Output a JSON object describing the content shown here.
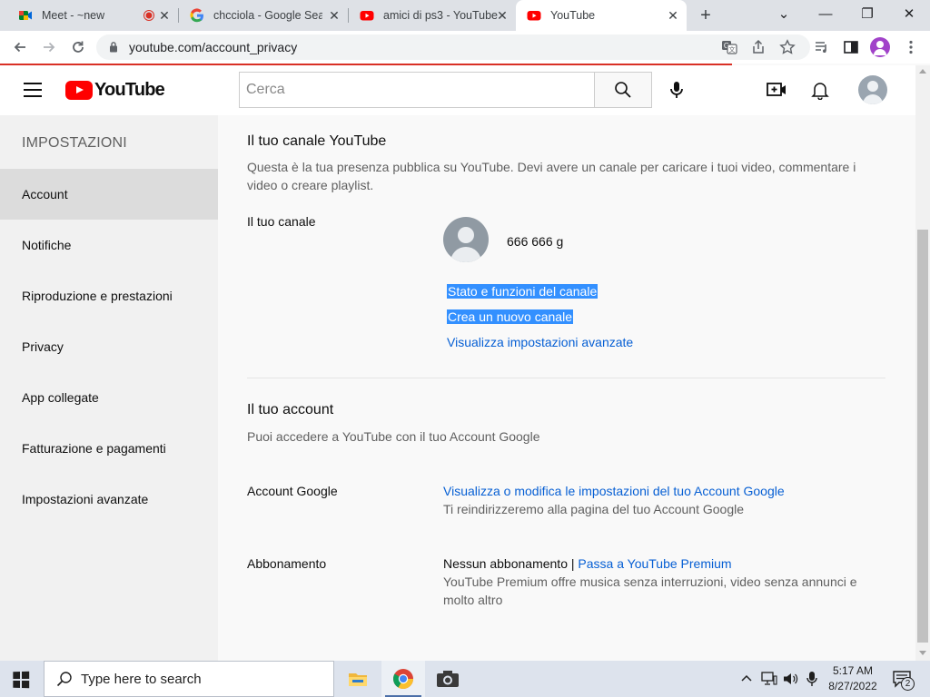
{
  "browser": {
    "tabs": [
      {
        "title": "Meet - ~new",
        "active": false
      },
      {
        "title": "chcciola - Google Search",
        "active": false
      },
      {
        "title": "amici di ps3 - YouTube",
        "active": false
      },
      {
        "title": "YouTube",
        "active": true
      }
    ],
    "url": "youtube.com/account_privacy",
    "new_tab_glyph": "+",
    "window_controls": {
      "menu": "⌄",
      "minimize": "—",
      "restore": "❐",
      "close": "✕"
    }
  },
  "masthead": {
    "logo_text": "YouTube",
    "search_placeholder": "Cerca"
  },
  "sidebar": {
    "heading": "IMPOSTAZIONI",
    "items": [
      {
        "label": "Account",
        "selected": true
      },
      {
        "label": "Notifiche",
        "selected": false
      },
      {
        "label": "Riproduzione e prestazioni",
        "selected": false
      },
      {
        "label": "Privacy",
        "selected": false
      },
      {
        "label": "App collegate",
        "selected": false
      },
      {
        "label": "Fatturazione e pagamenti",
        "selected": false
      },
      {
        "label": "Impostazioni avanzate",
        "selected": false
      }
    ]
  },
  "channel_section": {
    "title": "Il tuo canale YouTube",
    "description": "Questa è la tua presenza pubblica su YouTube. Devi avere un canale per caricare i tuoi video, commentare i video o creare playlist.",
    "your_channel_label": "Il tuo canale",
    "channel_name": "666 666 g",
    "links": {
      "status": "Stato e funzioni del canale",
      "create": "Crea un nuovo canale",
      "advanced": "Visualizza impostazioni avanzate"
    }
  },
  "account_section": {
    "title": "Il tuo account",
    "description": "Puoi accedere a YouTube con il tuo Account Google",
    "google_account": {
      "label": "Account Google",
      "link": "Visualizza o modifica le impostazioni del tuo Account Google",
      "note": "Ti reindirizzeremo alla pagina del tuo Account Google"
    },
    "subscription": {
      "label": "Abbonamento",
      "status": "Nessun abbonamento",
      "separator": "|",
      "link": "Passa a YouTube Premium",
      "note": "YouTube Premium offre musica senza interruzioni, video senza annunci e molto altro"
    }
  },
  "taskbar": {
    "search_placeholder": "Type here to search",
    "time": "5:17 AM",
    "date": "8/27/2022",
    "notification_count": "2"
  },
  "colors": {
    "youtube_red": "#ff0000",
    "link_blue": "#065fd4",
    "selection_blue": "#3390ff",
    "sidebar_selected": "#dcdcdc"
  }
}
